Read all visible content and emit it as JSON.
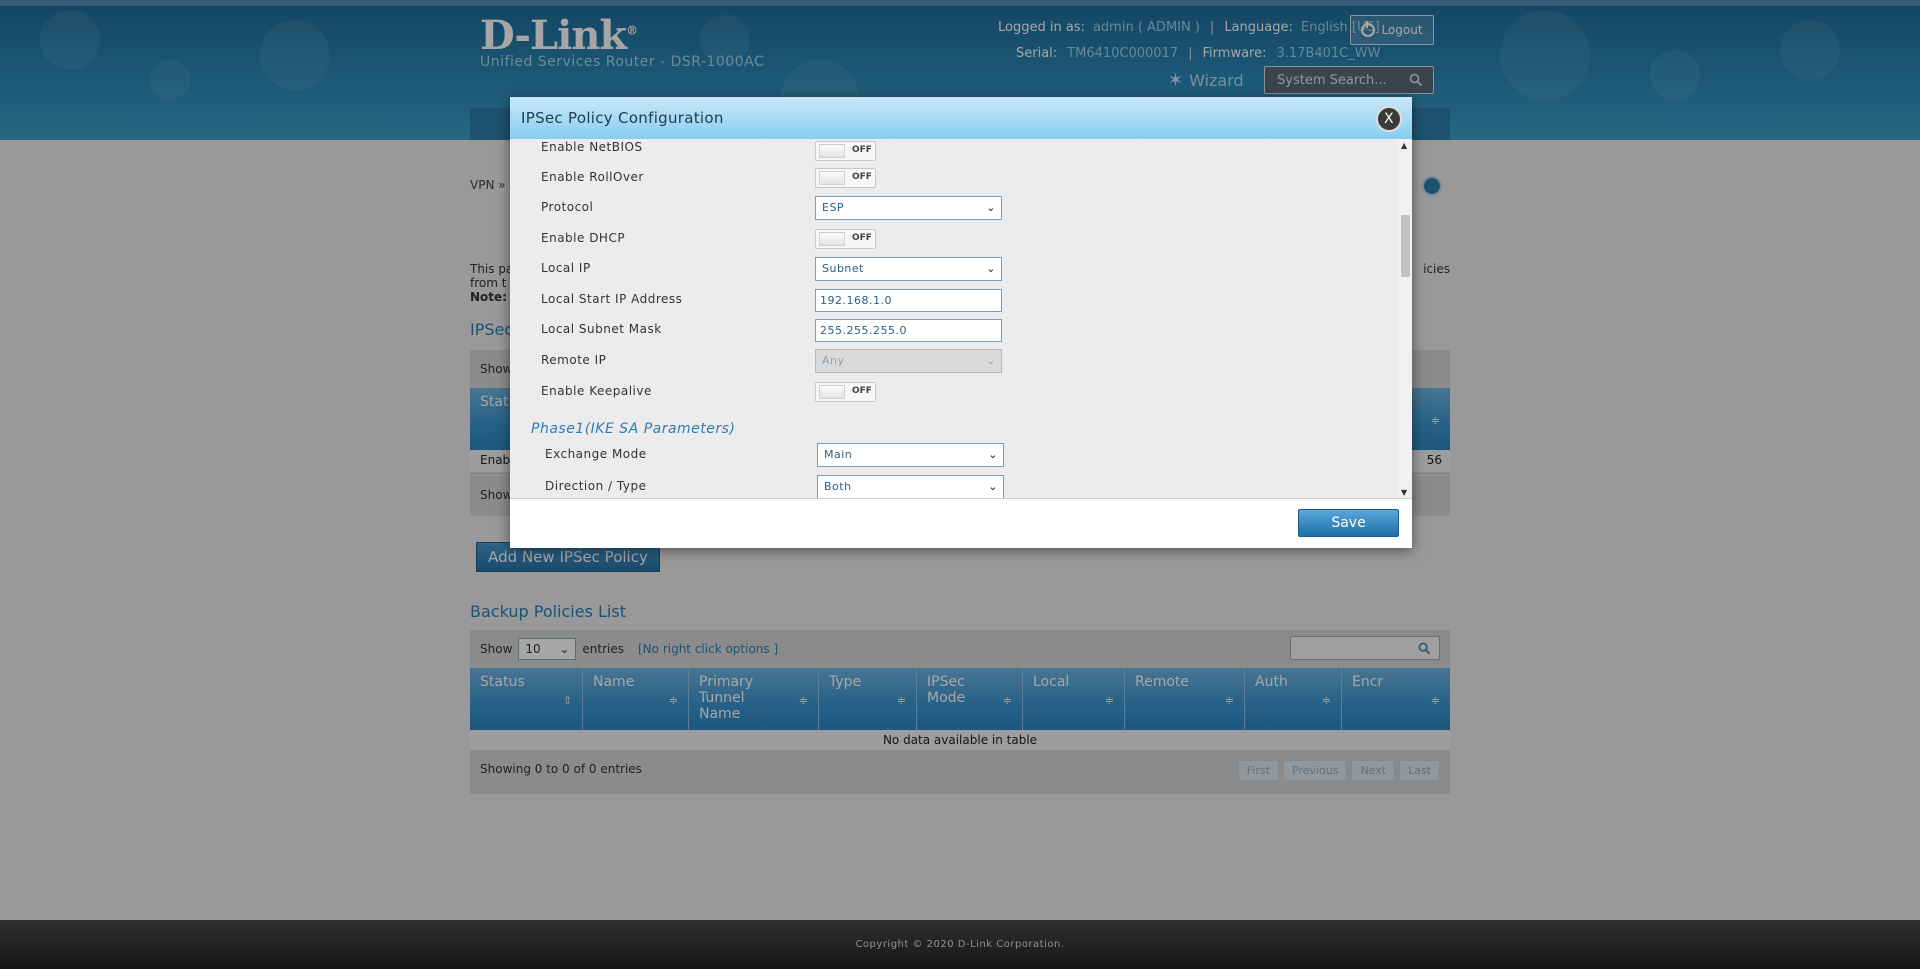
{
  "header": {
    "brand": "D-Link",
    "subtitle": "Unified Services Router - DSR-1000AC",
    "logged_in_label": "Logged in as:",
    "logged_in_value": "admin ( ADMIN )",
    "language_label": "Language:",
    "language_value": "English [US]",
    "logout_label": "Logout",
    "serial_label": "Serial:",
    "serial_value": "TM6410C000017",
    "firmware_label": "Firmware:",
    "firmware_value": "3.17B401C_WW",
    "wizard_label": "Wizard",
    "search_placeholder": "System Search..."
  },
  "page": {
    "breadcrumb": "VPN »",
    "desc_line1": "This pa",
    "desc_line1_end": "icies",
    "desc_line2": "from t",
    "note_label": "Note:",
    "ipsec_title": "IPSec",
    "ipsec_table": {
      "show_label": "Show",
      "status_head": "Stat",
      "row_status": "Enab",
      "row_end": "56",
      "footer_show": "Show"
    },
    "add_button": "Add New IPSec Policy",
    "backup_title": "Backup Policies List",
    "backup_table": {
      "show_label": "Show",
      "show_value": "10",
      "entries_label": "entries",
      "right_click_note": "[No right click options ]",
      "columns": [
        "Status",
        "Name",
        "Primary Tunnel Name",
        "Type",
        "IPSec Mode",
        "Local",
        "Remote",
        "Auth",
        "Encr"
      ],
      "empty_message": "No data available in table",
      "showing": "Showing 0 to 0 of 0 entries",
      "pager": [
        "First",
        "Previous",
        "Next",
        "Last"
      ]
    }
  },
  "modal": {
    "title": "IPSec Policy Configuration",
    "close_label": "X",
    "fields": {
      "netbios_label": "Enable NetBIOS",
      "netbios_state": "OFF",
      "rollover_label": "Enable RollOver",
      "rollover_state": "OFF",
      "protocol_label": "Protocol",
      "protocol_value": "ESP",
      "dhcp_label": "Enable DHCP",
      "dhcp_state": "OFF",
      "local_ip_label": "Local IP",
      "local_ip_value": "Subnet",
      "local_start_label": "Local Start IP Address",
      "local_start_value": "192.168.1.0",
      "local_mask_label": "Local Subnet Mask",
      "local_mask_value": "255.255.255.0",
      "remote_ip_label": "Remote IP",
      "remote_ip_value": "Any",
      "keepalive_label": "Enable Keepalive",
      "keepalive_state": "OFF",
      "phase1_title": "Phase1(IKE SA Parameters)",
      "exchange_label": "Exchange Mode",
      "exchange_value": "Main",
      "direction_label": "Direction / Type",
      "direction_value": "Both"
    },
    "save_label": "Save"
  },
  "footer": {
    "copyright": "Copyright © 2020 D-Link Corporation."
  }
}
